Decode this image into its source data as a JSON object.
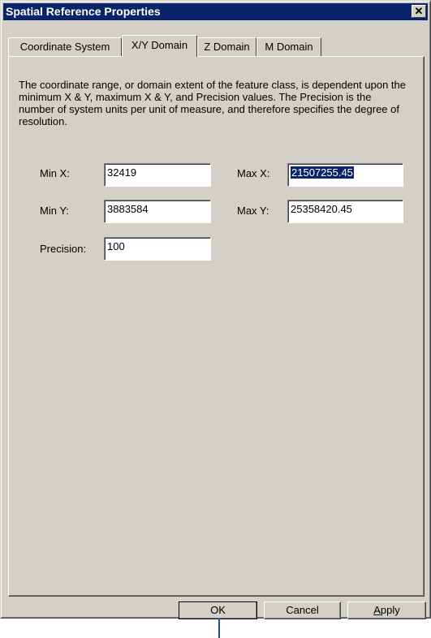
{
  "window": {
    "title": "Spatial Reference Properties",
    "close_glyph": "✕"
  },
  "tabs": [
    {
      "label": "Coordinate System",
      "active": false
    },
    {
      "label": "X/Y Domain",
      "active": true
    },
    {
      "label": "Z Domain",
      "active": false
    },
    {
      "label": "M Domain",
      "active": false
    }
  ],
  "panel": {
    "description": "The coordinate range, or domain extent of the feature class, is dependent upon the minimum X & Y, maximum X & Y, and Precision values. The Precision is the number of system units per unit of measure, and therefore specifies the degree of resolution.",
    "min_x": {
      "label": "Min X:",
      "value": "32419"
    },
    "min_y": {
      "label": "Min Y:",
      "value": "3883584"
    },
    "max_x": {
      "label": "Max X:",
      "value": "21507255.45",
      "selected": true
    },
    "max_y": {
      "label": "Max Y:",
      "value": "25358420.45"
    },
    "precision": {
      "label": "Precision:",
      "value": "100"
    }
  },
  "buttons": {
    "ok": "OK",
    "cancel": "Cancel",
    "apply_first": "A",
    "apply_rest": "pply"
  },
  "colors": {
    "titlebar": "#0a246a",
    "face": "#d4d0c8",
    "selection": "#0a246a",
    "pointer": "#1f4f8f"
  }
}
